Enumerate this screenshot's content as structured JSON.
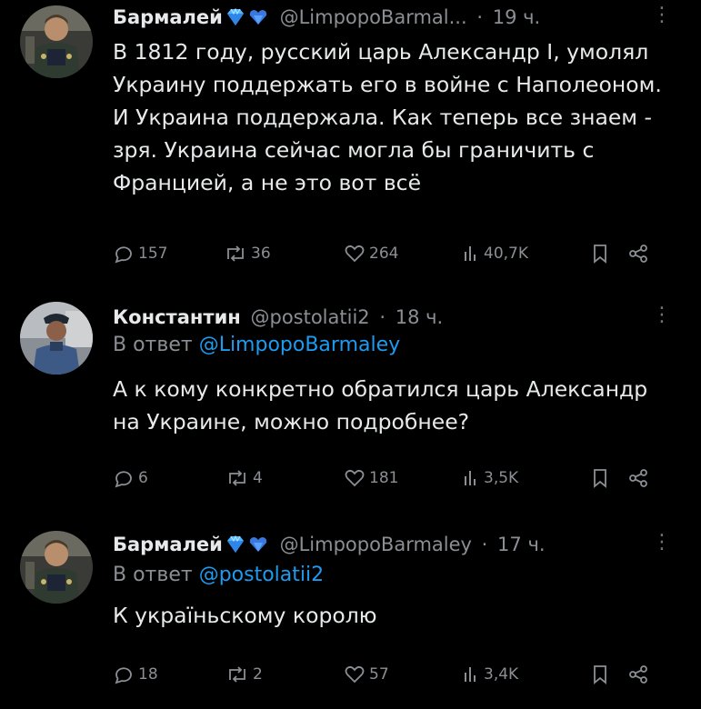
{
  "tweets": [
    {
      "name": "Бармалей",
      "handle": "@LimpopoBarmal...",
      "sep": "·",
      "time": "19 ч.",
      "text": "В 1812 году, русский царь Александр I, умолял Украину поддержать его в войне с Наполеоном. И Украина поддержала. Как теперь все знаем - зря. Украина сейчас могла бы граничить с Францией, а не это вот всё",
      "stats": {
        "replies": "157",
        "retweets": "36",
        "likes": "264",
        "views": "40,7K"
      },
      "badge_colors": [
        "#4fb6ff",
        "#3a78e0"
      ]
    },
    {
      "name": "Константин",
      "handle": "@postolatii2",
      "sep": "·",
      "time": "18 ч.",
      "reply_prefix": "В ответ",
      "reply_to": "@LimpopoBarmaley",
      "text": "А к кому конкретно обратился царь Александр на Украине, можно подробнее?",
      "stats": {
        "replies": "6",
        "retweets": "4",
        "likes": "181",
        "views": "3,5K"
      }
    },
    {
      "name": "Бармалей",
      "handle": "@LimpopoBarmaley",
      "sep": "·",
      "time": "17 ч.",
      "reply_prefix": "В ответ",
      "reply_to": "@postolatii2",
      "text": "К україньскому королю",
      "stats": {
        "replies": "18",
        "retweets": "2",
        "likes": "57",
        "views": "3,4K"
      }
    }
  ],
  "colors": {
    "accent": "#1d9bf0",
    "muted": "#8b8f94",
    "text": "#e7e9ea",
    "background": "#000000"
  }
}
